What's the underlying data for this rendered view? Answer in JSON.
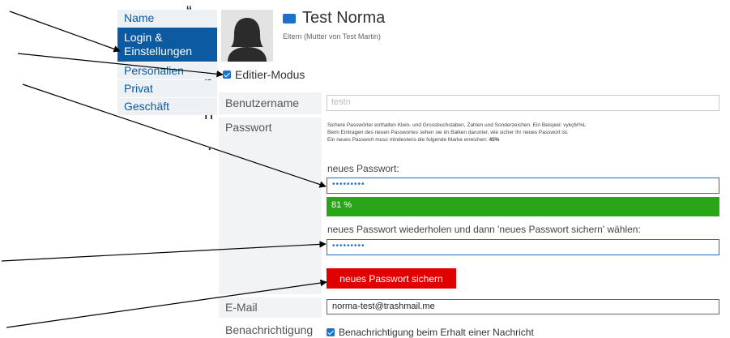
{
  "margin_fragments": [
    "“",
    "n",
    "n",
    "."
  ],
  "sidebar": {
    "items": [
      {
        "label": "Name",
        "active": false
      },
      {
        "label": "Login & Einstellungen",
        "active": true
      },
      {
        "label": "Personalien",
        "active": false
      },
      {
        "label": "Privat",
        "active": false
      },
      {
        "label": "Geschäft",
        "active": false
      }
    ]
  },
  "profile": {
    "name": "Test Norma",
    "subtitle": "Eltern (Mutter von Test Martin)"
  },
  "edit_mode": {
    "label": "Editier-Modus",
    "checked": true
  },
  "form": {
    "username_label": "Benutzername",
    "username_value": "testn",
    "password_label": "Passwort",
    "hint_line1": "Sichere Passwörter enthalten Klein- und Grossbuchstaben, Zahlen und Sonderzeichen. Ein Beispiel: vykç6r%L",
    "hint_line2": "Beim Eintragen des neuen Passwortes sehen sie im Balken darunter, wie sicher Ihr neues Passwort ist.",
    "hint_line3_prefix": "Ein neues Passwort muss mindestens die folgende Marke erreichen:",
    "hint_line3_value": "45%",
    "new_password_label": "neues Passwort:",
    "new_password_value": "•••••••••",
    "strength_text": "81 %",
    "strength_value": 81,
    "repeat_label": "neues Passwort wiederholen und dann 'neues Passwort sichern' wählen:",
    "repeat_value": "•••••••••",
    "save_button": "neues Passwort sichern",
    "email_label": "E-Mail",
    "email_value": "norma-test@trashmail.me",
    "notify_label": "Benachrichtigung",
    "notify_checkbox_label": "Benachrichtigung beim Erhalt einer Nachricht"
  },
  "colors": {
    "accent": "#1a73c9",
    "sidebar_active": "#0b5aa2",
    "strength_bar": "#2aa418",
    "save_button": "#e00000"
  }
}
